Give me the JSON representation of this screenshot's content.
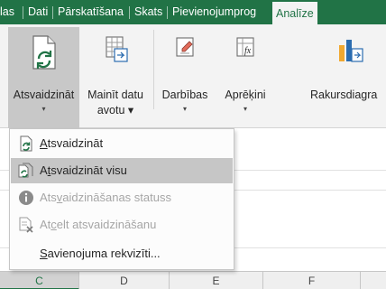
{
  "tabs": [
    {
      "label": "las"
    },
    {
      "label": "Dati"
    },
    {
      "label": "Pārskatīšana"
    },
    {
      "label": "Skats"
    },
    {
      "label": "Pievienojumprog"
    },
    {
      "label": "Analīze"
    }
  ],
  "ribbon": {
    "refresh": {
      "line1": "Atsvaidzināt",
      "arrow": "▾"
    },
    "change_source": {
      "line1": "Mainīt datu",
      "line2": "avotu ▾"
    },
    "actions": {
      "line1": "Darbības",
      "arrow": "▾"
    },
    "calculations": {
      "line1": "Aprēķini",
      "arrow": "▾"
    },
    "pivotchart": {
      "line1": "Rakursdiagra"
    }
  },
  "menu": {
    "items": [
      {
        "label": "Atsvaidzināt",
        "accel": "A"
      },
      {
        "label": "Atsvaidzināt visu",
        "accel": "t"
      },
      {
        "label": "Atsvaidzināšanas statuss",
        "accel": "v"
      },
      {
        "label": "Atcelt atsvaidzināšanu",
        "accel": "c"
      },
      {
        "label": "Savienojuma rekvizīti...",
        "accel": "S"
      }
    ]
  },
  "columns": [
    "C",
    "D",
    "E",
    "F"
  ],
  "colors": {
    "accent": "#217346",
    "hover": "#c6c6c6",
    "disabled": "#a6a6a6"
  }
}
